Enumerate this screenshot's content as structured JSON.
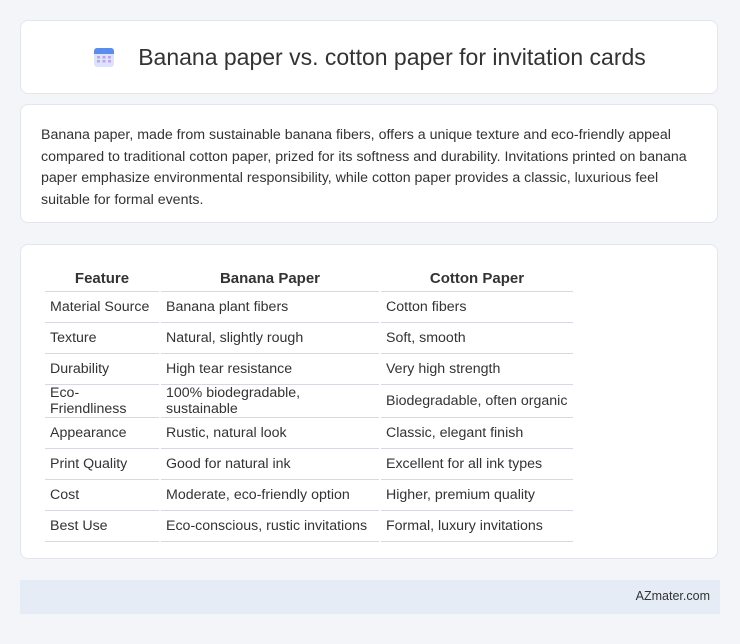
{
  "header": {
    "title": "Banana paper vs. cotton paper for invitation cards",
    "icon": "calendar-icon"
  },
  "intro": {
    "text": "Banana paper, made from sustainable banana fibers, offers a unique texture and eco-friendly appeal compared to traditional cotton paper, prized for its softness and durability. Invitations printed on banana paper emphasize environmental responsibility, while cotton paper provides a classic, luxurious feel suitable for formal events."
  },
  "table": {
    "headers": [
      "Feature",
      "Banana Paper",
      "Cotton Paper"
    ],
    "rows": [
      [
        "Material Source",
        "Banana plant fibers",
        "Cotton fibers"
      ],
      [
        "Texture",
        "Natural, slightly rough",
        "Soft, smooth"
      ],
      [
        "Durability",
        "High tear resistance",
        "Very high strength"
      ],
      [
        "Eco-Friendliness",
        "100% biodegradable, sustainable",
        "Biodegradable, often organic"
      ],
      [
        "Appearance",
        "Rustic, natural look",
        "Classic, elegant finish"
      ],
      [
        "Print Quality",
        "Good for natural ink",
        "Excellent for all ink types"
      ],
      [
        "Cost",
        "Moderate, eco-friendly option",
        "Higher, premium quality"
      ],
      [
        "Best Use",
        "Eco-conscious, rustic invitations",
        "Formal, luxury invitations"
      ]
    ]
  },
  "footer": {
    "brand": "AZmater.com"
  }
}
